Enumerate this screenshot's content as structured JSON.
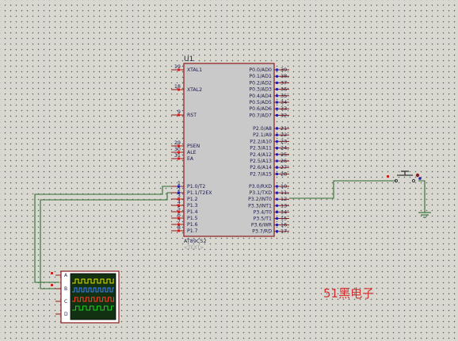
{
  "mcu": {
    "ref": "U1",
    "part": "AT89C52",
    "text_hint": "<TEXT>",
    "left_pins": [
      {
        "num": "19",
        "label": "XTAL1"
      },
      {
        "num": "18",
        "label": "XTAL2"
      },
      {
        "num": "9",
        "label": "RST"
      },
      {
        "num": "29",
        "label": "PSEN"
      },
      {
        "num": "30",
        "label": "ALE"
      },
      {
        "num": "31",
        "label": "EA"
      },
      {
        "num": "1",
        "label": "P1.0/T2"
      },
      {
        "num": "2",
        "label": "P1.1/T2EX"
      },
      {
        "num": "3",
        "label": "P1.2"
      },
      {
        "num": "4",
        "label": "P1.3"
      },
      {
        "num": "5",
        "label": "P1.4"
      },
      {
        "num": "6",
        "label": "P1.5"
      },
      {
        "num": "7",
        "label": "P1.6"
      },
      {
        "num": "8",
        "label": "P1.7"
      }
    ],
    "right_pins": [
      {
        "num": "39",
        "label": "P0.0/AD0"
      },
      {
        "num": "38",
        "label": "P0.1/AD1"
      },
      {
        "num": "37",
        "label": "P0.2/AD2"
      },
      {
        "num": "36",
        "label": "P0.3/AD3"
      },
      {
        "num": "35",
        "label": "P0.4/AD4"
      },
      {
        "num": "34",
        "label": "P0.5/AD5"
      },
      {
        "num": "33",
        "label": "P0.6/AD6"
      },
      {
        "num": "32",
        "label": "P0.7/AD7"
      },
      {
        "num": "21",
        "label": "P2.0/A8"
      },
      {
        "num": "22",
        "label": "P2.1/A9"
      },
      {
        "num": "23",
        "label": "P2.2/A10"
      },
      {
        "num": "24",
        "label": "P2.3/A11"
      },
      {
        "num": "25",
        "label": "P2.4/A12"
      },
      {
        "num": "26",
        "label": "P2.5/A13"
      },
      {
        "num": "27",
        "label": "P2.6/A14"
      },
      {
        "num": "28",
        "label": "P2.7/A15"
      },
      {
        "num": "10",
        "label": "P3.0/RXD"
      },
      {
        "num": "11",
        "label": "P3.1/TXD"
      },
      {
        "num": "12",
        "label": "P3.2/INT0"
      },
      {
        "num": "13",
        "label": "P3.3/INT1"
      },
      {
        "num": "14",
        "label": "P3.4/T0"
      },
      {
        "num": "15",
        "label": "P3.5/T1"
      },
      {
        "num": "16",
        "label": "P3.6/WR"
      },
      {
        "num": "17",
        "label": "P3.7/RD"
      }
    ]
  },
  "oscilloscope": {
    "channels": [
      "A",
      "B",
      "C",
      "D"
    ],
    "trace_colors": [
      "#e8e800",
      "#3f7fff",
      "#ff4020",
      "#20d020"
    ]
  },
  "colors": {
    "wire": "#2e6b2e",
    "chip_fill": "#c9c9c9",
    "chip_border": "#8b1a1a",
    "pin_line": "#8b1a1a",
    "text": "#1b1b4a",
    "watermark": "#d23030"
  },
  "watermark": "51黑电子"
}
